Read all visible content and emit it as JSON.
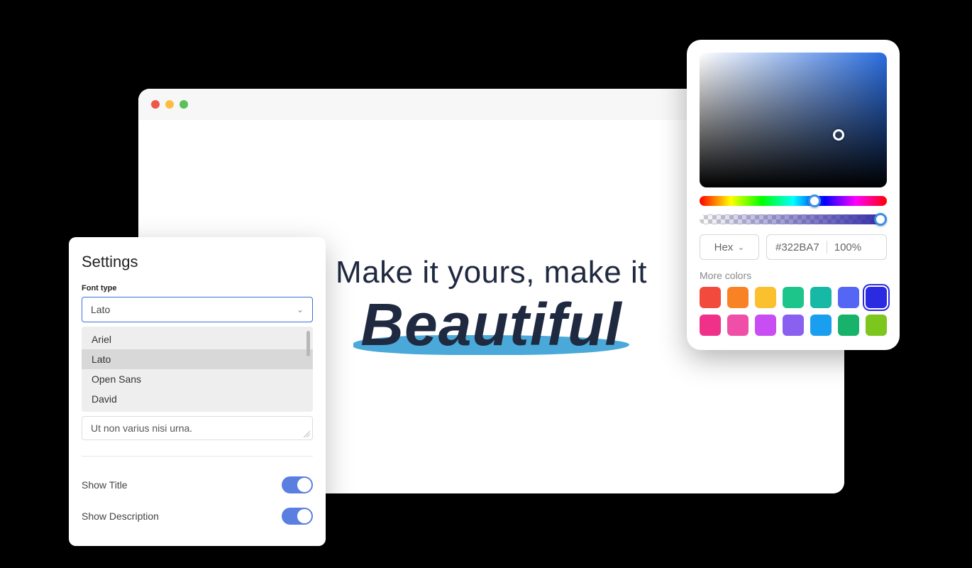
{
  "browser": {
    "hero_top": "Make it yours, make it",
    "hero_bottom": "Beautiful"
  },
  "settings": {
    "title": "Settings",
    "font_label": "Font type",
    "font_selected": "Lato",
    "font_options": [
      "Ariel",
      "Lato",
      "Open Sans",
      "David"
    ],
    "textarea_value": "Ut non varius nisi urna.",
    "toggle_title": "Show Title",
    "toggle_desc": "Show Description"
  },
  "picker": {
    "format": "Hex",
    "hex": "#322BA7",
    "opacity": "100%",
    "more_label": "More colors",
    "hue_thumb_left": "58%",
    "alpha_thumb_left": "93%",
    "swatches": [
      {
        "c": "#f24a3d",
        "sel": false
      },
      {
        "c": "#f98324",
        "sel": false
      },
      {
        "c": "#fbc02d",
        "sel": false
      },
      {
        "c": "#1ec58a",
        "sel": false
      },
      {
        "c": "#17b8a6",
        "sel": false
      },
      {
        "c": "#5566f4",
        "sel": false
      },
      {
        "c": "#2a2ae0",
        "sel": true
      },
      {
        "c": "#f0318a",
        "sel": false
      },
      {
        "c": "#ef4fa6",
        "sel": false
      },
      {
        "c": "#c84df2",
        "sel": false
      },
      {
        "c": "#8a60f1",
        "sel": false
      },
      {
        "c": "#1a9ff0",
        "sel": false
      },
      {
        "c": "#17b36a",
        "sel": false
      },
      {
        "c": "#7cc61e",
        "sel": false
      }
    ]
  }
}
